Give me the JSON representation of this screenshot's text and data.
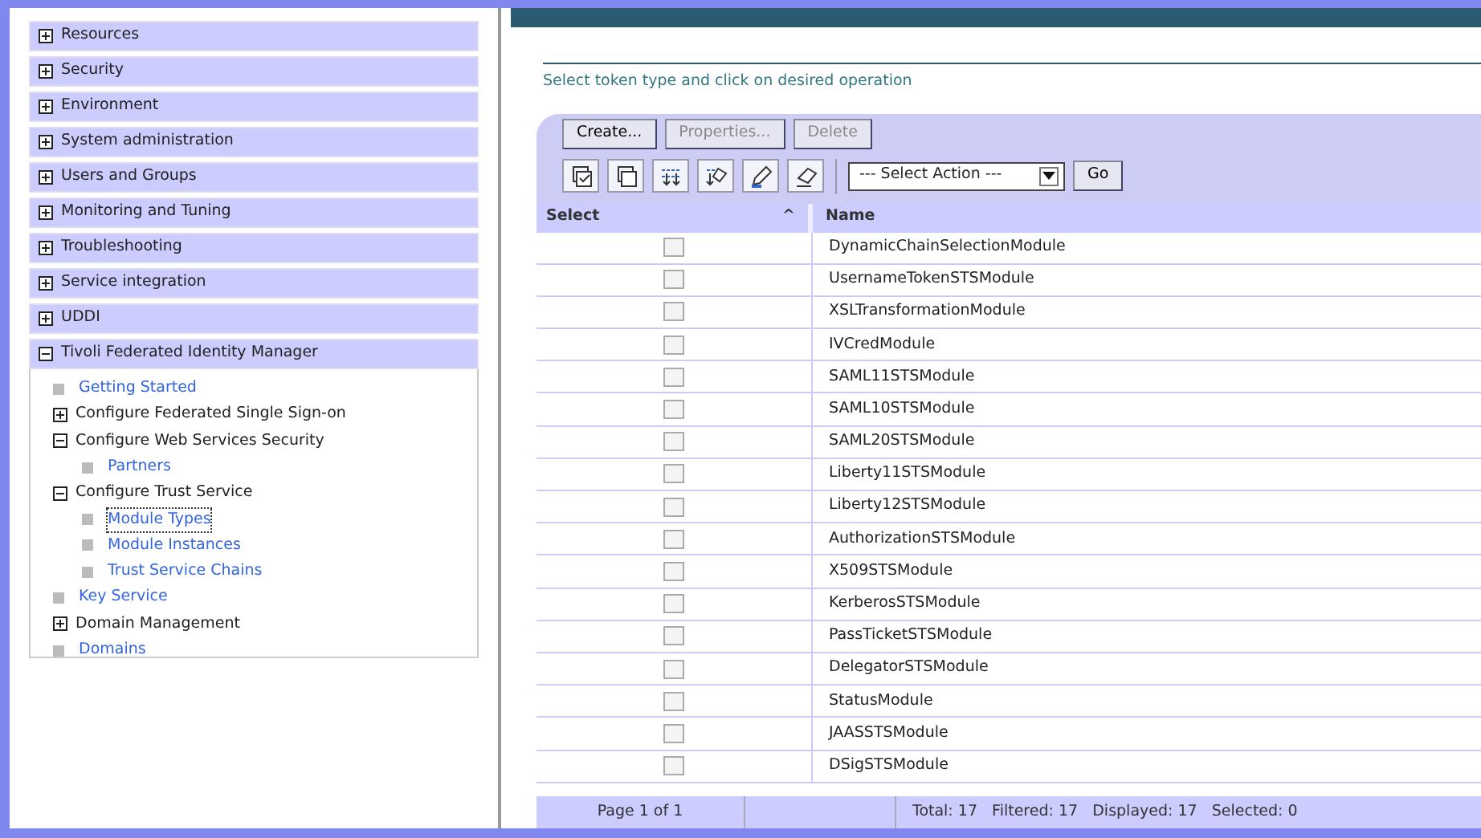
{
  "nav": [
    {
      "label": "Resources",
      "expanded": false
    },
    {
      "label": "Security",
      "expanded": false
    },
    {
      "label": "Environment",
      "expanded": false
    },
    {
      "label": "System administration",
      "expanded": false
    },
    {
      "label": "Users and Groups",
      "expanded": false
    },
    {
      "label": "Monitoring and Tuning",
      "expanded": false
    },
    {
      "label": "Troubleshooting",
      "expanded": false
    },
    {
      "label": "Service integration",
      "expanded": false
    },
    {
      "label": "UDDI",
      "expanded": false
    },
    {
      "label": "Tivoli Federated Identity Manager",
      "expanded": true,
      "children": [
        {
          "kind": "link",
          "label": "Getting Started",
          "selected": false
        },
        {
          "kind": "folder",
          "label": "Configure Federated Single Sign-on",
          "expanded": false
        },
        {
          "kind": "folder",
          "label": "Configure Web Services Security",
          "expanded": true,
          "children": [
            {
              "kind": "link",
              "label": "Partners",
              "selected": false
            }
          ]
        },
        {
          "kind": "folder",
          "label": "Configure Trust Service",
          "expanded": true,
          "children": [
            {
              "kind": "link",
              "label": "Module Types",
              "selected": true
            },
            {
              "kind": "link",
              "label": "Module Instances",
              "selected": false
            },
            {
              "kind": "link",
              "label": "Trust Service Chains",
              "selected": false
            }
          ]
        },
        {
          "kind": "link",
          "label": "Key Service",
          "selected": false
        },
        {
          "kind": "folder",
          "label": "Domain Management",
          "expanded": false
        },
        {
          "kind": "link",
          "label": "Domains",
          "selected": false
        }
      ]
    }
  ],
  "instruction": "Select token type and click on desired operation",
  "buttons": [
    {
      "label": "Create...",
      "disabled": false
    },
    {
      "label": "Properties...",
      "disabled": true
    },
    {
      "label": "Delete",
      "disabled": true
    }
  ],
  "action_select": {
    "value": "--- Select Action ---"
  },
  "go_button": "Go",
  "table": {
    "columns": [
      "Select",
      "Name"
    ],
    "sort_mark": "^",
    "rows": [
      {
        "name": "DynamicChainSelectionModule",
        "checked": false
      },
      {
        "name": "UsernameTokenSTSModule",
        "checked": false
      },
      {
        "name": "XSLTransformationModule",
        "checked": false
      },
      {
        "name": "IVCredModule",
        "checked": false
      },
      {
        "name": "SAML11STSModule",
        "checked": false
      },
      {
        "name": "SAML10STSModule",
        "checked": false
      },
      {
        "name": "SAML20STSModule",
        "checked": false
      },
      {
        "name": "Liberty11STSModule",
        "checked": false
      },
      {
        "name": "Liberty12STSModule",
        "checked": false
      },
      {
        "name": "AuthorizationSTSModule",
        "checked": false
      },
      {
        "name": "X509STSModule",
        "checked": false
      },
      {
        "name": "KerberosSTSModule",
        "checked": false
      },
      {
        "name": "PassTicketSTSModule",
        "checked": false
      },
      {
        "name": "DelegatorSTSModule",
        "checked": false
      },
      {
        "name": "StatusModule",
        "checked": false
      },
      {
        "name": "JAASSTSModule",
        "checked": false
      },
      {
        "name": "DSigSTSModule",
        "checked": false
      }
    ]
  },
  "footer": {
    "page": "Page 1 of 1",
    "summary": "Total: 17   Filtered: 17   Displayed: 17   Selected: 0"
  }
}
